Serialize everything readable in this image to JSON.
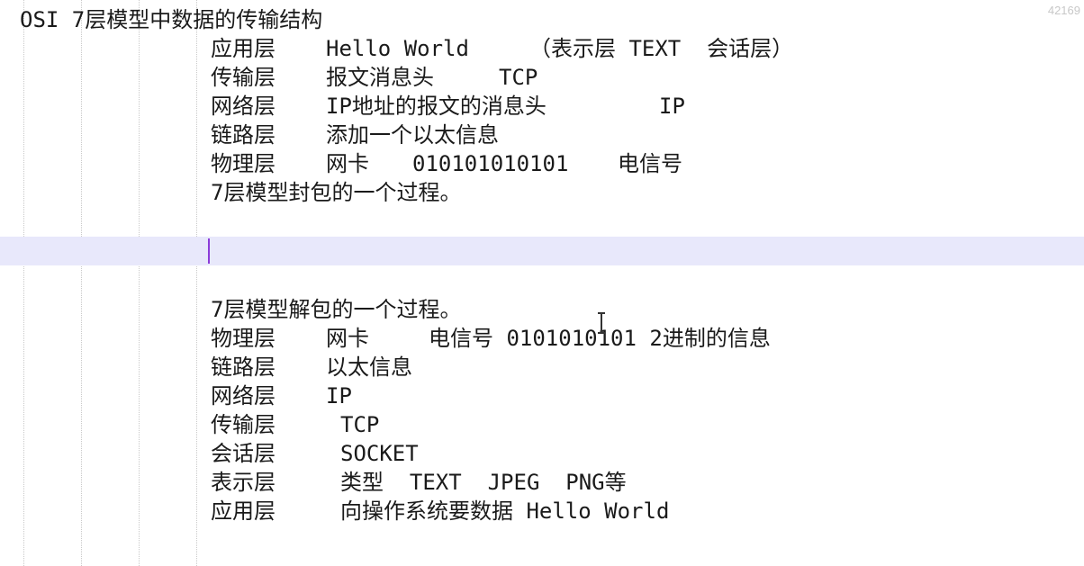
{
  "status": {
    "line_number": "42169"
  },
  "lines": {
    "title": "OSI 7层模型中数据的传输结构",
    "enc": [
      {
        "layer": "应用层",
        "c1": "Hello World",
        "c2": "（表示层 TEXT  会话层）"
      },
      {
        "layer": "传输层",
        "c1": "报文消息头",
        "c2": "TCP"
      },
      {
        "layer": "网络层",
        "c1": "IP地址的报文的消息头",
        "c2": "IP"
      },
      {
        "layer": "链路层",
        "c1": "添加一个以太信息",
        "c2": ""
      },
      {
        "layer": "物理层",
        "c1": "网卡",
        "c2": "010101010101",
        "c3": "电信号"
      }
    ],
    "enc_summary": "7层模型封包的一个过程。",
    "dec_summary": "7层模型解包的一个过程。",
    "dec": [
      {
        "layer": "物理层",
        "c1": "网卡",
        "c2": "电信号 0101010101 2进制的信息"
      },
      {
        "layer": "链路层",
        "c1": "以太信息"
      },
      {
        "layer": "网络层",
        "c1": "IP"
      },
      {
        "layer": "传输层",
        "c1": "TCP"
      },
      {
        "layer": "会话层",
        "c1": "SOCKET"
      },
      {
        "layer": "表示层",
        "c1": "类型  TEXT  JPEG  PNG等"
      },
      {
        "layer": "应用层",
        "c1": "向操作系统要数据 Hello World"
      }
    ]
  }
}
